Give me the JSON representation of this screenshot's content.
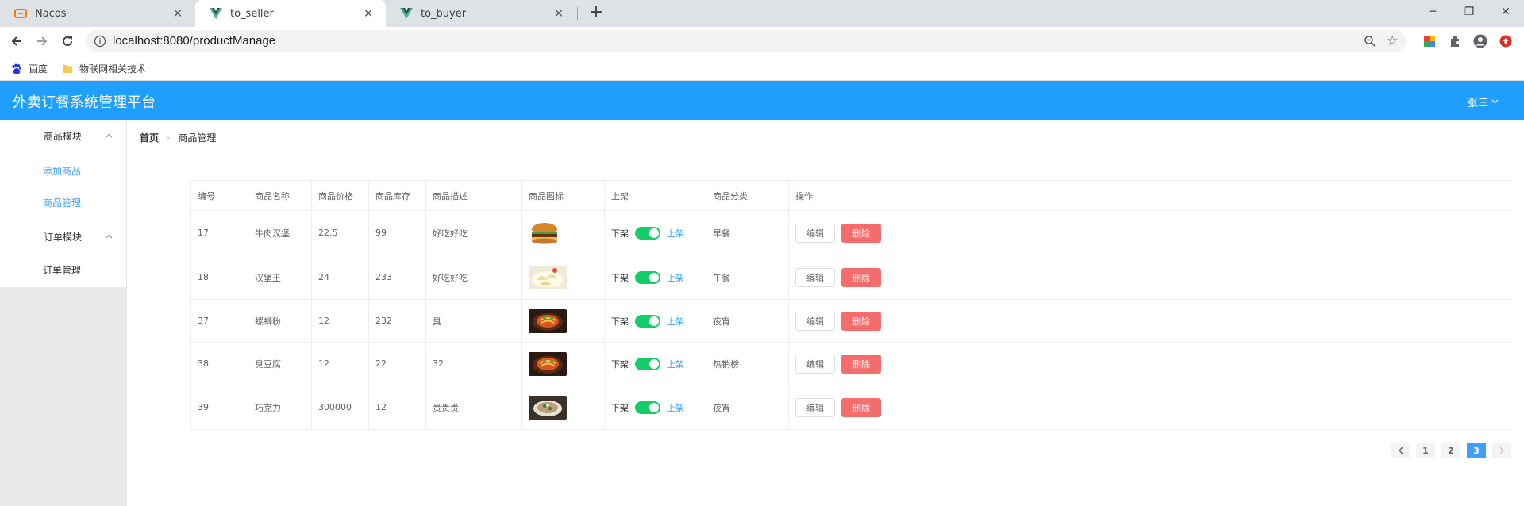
{
  "browser": {
    "tabs": [
      {
        "label": "Nacos",
        "icon": "nacos-icon",
        "active": false
      },
      {
        "label": "to_seller",
        "icon": "vue-icon",
        "active": true
      },
      {
        "label": "to_buyer",
        "icon": "vue-icon",
        "active": false
      }
    ],
    "url": "localhost:8080/productManage",
    "bookmarks": [
      {
        "label": "百度",
        "icon": "baidu-icon"
      },
      {
        "label": "物联网相关技术",
        "icon": "folder-icon"
      }
    ]
  },
  "app": {
    "title": "外卖订餐系统管理平台",
    "user": "张三",
    "colors": {
      "header": "#1f9efd",
      "accent": "#409eff",
      "danger": "#f56c6c",
      "switch_on": "#13ce66"
    }
  },
  "sidebar": {
    "groups": [
      {
        "label": "商品模块",
        "items": [
          "添加商品",
          "商品管理"
        ]
      },
      {
        "label": "订单模块",
        "items": [
          "订单管理"
        ]
      }
    ],
    "active_item": "商品管理"
  },
  "breadcrumb": {
    "home": "首页",
    "current": "商品管理"
  },
  "table": {
    "headers": [
      "编号",
      "商品名称",
      "商品价格",
      "商品库存",
      "商品描述",
      "商品图标",
      "上架",
      "商品分类",
      "操作"
    ],
    "rows": [
      {
        "id": "17",
        "name": "牛肉汉堡",
        "price": "22.5",
        "stock": "99",
        "desc": "好吃好吃",
        "image": "burger",
        "category": "早餐"
      },
      {
        "id": "18",
        "name": "汉堡王",
        "price": "24",
        "stock": "233",
        "desc": "好吃好吃",
        "image": "dumplings",
        "category": "午餐"
      },
      {
        "id": "37",
        "name": "螺蛳粉",
        "price": "12",
        "stock": "232",
        "desc": "臭",
        "image": "noodles",
        "category": "夜宵"
      },
      {
        "id": "38",
        "name": "臭豆腐",
        "price": "12",
        "stock": "22",
        "desc": "32",
        "image": "noodles",
        "category": "热销榜"
      },
      {
        "id": "39",
        "name": "巧克力",
        "price": "300000",
        "stock": "12",
        "desc": "贵贵贵",
        "image": "bowl",
        "category": "夜宵"
      }
    ],
    "switch": {
      "off_label": "下架",
      "on_label": "上架"
    },
    "actions": {
      "edit": "编辑",
      "delete": "删除"
    }
  },
  "pagination": {
    "pages": [
      "1",
      "2",
      "3"
    ],
    "current": "3"
  }
}
